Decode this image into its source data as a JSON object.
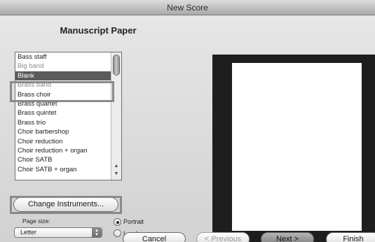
{
  "window": {
    "title": "New Score"
  },
  "heading": "Manuscript Paper",
  "list": {
    "items": [
      "Bass staff",
      "Big band",
      "Blank",
      "Brass band",
      "Brass choir",
      "Brass quartet",
      "Brass quintet",
      "Brass trio",
      "Choir barbershop",
      "Choir reduction",
      "Choir reduction + organ",
      "Choir SATB",
      "Choir SATB + organ"
    ],
    "selected": "Blank"
  },
  "buttons": {
    "change_instruments": "Change Instruments...",
    "cancel": "Cancel",
    "previous": "< Previous",
    "next": "Next >",
    "finish": "Finish"
  },
  "page_size": {
    "label": "Page size:",
    "value": "Letter"
  },
  "orientation": {
    "portrait": "Portrait",
    "landscape": "Landscape",
    "selected": "Portrait"
  },
  "icons": {
    "scroll_up": "up-arrow-icon",
    "scroll_down": "down-arrow-icon",
    "popup": "updown-arrows-icon"
  }
}
